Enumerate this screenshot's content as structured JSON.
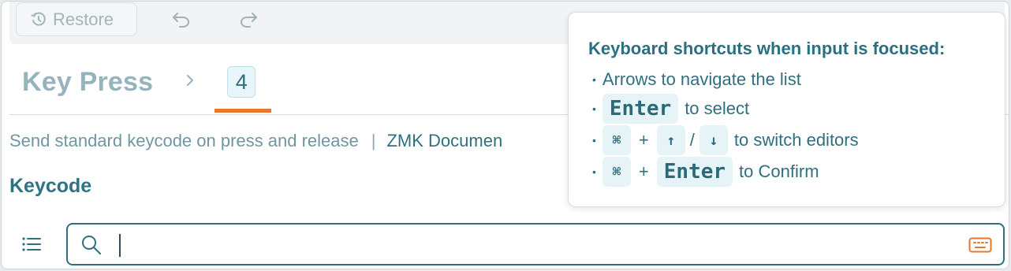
{
  "toolbar": {
    "restore_label": "Restore",
    "undo_icon": "undo-icon",
    "redo_icon": "redo-icon"
  },
  "breadcrumb": {
    "title": "Key Press",
    "value": "4"
  },
  "description": {
    "text": "Send standard keycode on press and release",
    "separator": "|",
    "link": "ZMK Documen"
  },
  "section": {
    "title": "Keycode"
  },
  "search": {
    "value": "",
    "placeholder": ""
  },
  "shortcuts": {
    "title": "Keyboard shortcuts when input is focused:",
    "bullet": "•",
    "row1": {
      "text": "Arrows to navigate the list"
    },
    "row2": {
      "key": "Enter",
      "text": "to select"
    },
    "row3": {
      "mod": "⌘",
      "plus": "+",
      "up": "↑",
      "slash": "/",
      "down": "↓",
      "text": "to switch editors"
    },
    "row4": {
      "mod": "⌘",
      "plus": "+",
      "key": "Enter",
      "text": "to Confirm"
    }
  },
  "colors": {
    "accent": "#2f6f7e",
    "tab_underline": "#e8762c",
    "muted": "#97b3bb",
    "keyboard_icon": "#e8762c"
  }
}
